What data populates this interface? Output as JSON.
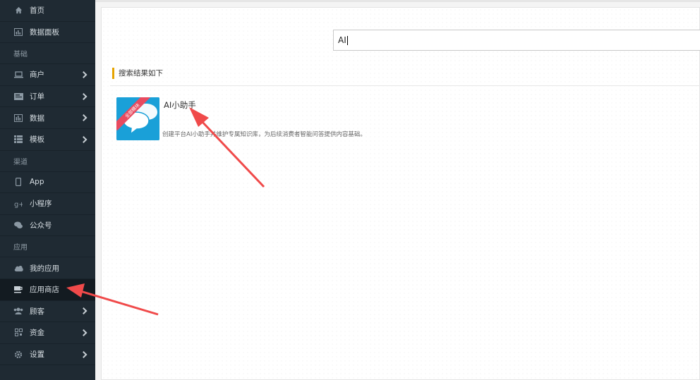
{
  "sidebar": {
    "items": [
      {
        "type": "item",
        "label": "首页",
        "icon": "home-icon",
        "chevron": false,
        "active": false
      },
      {
        "type": "item",
        "label": "数据面板",
        "icon": "chart-icon",
        "chevron": false,
        "active": false
      },
      {
        "type": "section",
        "label": "基础"
      },
      {
        "type": "item",
        "label": "商户",
        "icon": "laptop-icon",
        "chevron": true,
        "active": false
      },
      {
        "type": "item",
        "label": "订单",
        "icon": "order-card-icon",
        "chevron": true,
        "active": false
      },
      {
        "type": "item",
        "label": "数据",
        "icon": "bar-chart-icon",
        "chevron": true,
        "active": false
      },
      {
        "type": "item",
        "label": "模板",
        "icon": "list-icon",
        "chevron": true,
        "active": false
      },
      {
        "type": "section",
        "label": "渠道"
      },
      {
        "type": "item",
        "label": "App",
        "icon": "mobile-icon",
        "chevron": false,
        "active": false
      },
      {
        "type": "item",
        "label": "小程序",
        "icon": "miniprogram-icon",
        "chevron": false,
        "active": false
      },
      {
        "type": "item",
        "label": "公众号",
        "icon": "chat-bubbles-icon",
        "chevron": false,
        "active": false
      },
      {
        "type": "section",
        "label": "应用"
      },
      {
        "type": "item",
        "label": "我的应用",
        "icon": "cloud-icon",
        "chevron": false,
        "active": false
      },
      {
        "type": "item",
        "label": "应用商店",
        "icon": "cup-icon",
        "chevron": false,
        "active": true
      },
      {
        "type": "item",
        "label": "顾客",
        "icon": "users-icon",
        "chevron": true,
        "active": false
      },
      {
        "type": "item",
        "label": "资金",
        "icon": "qrcode-icon",
        "chevron": true,
        "active": false
      },
      {
        "type": "item",
        "label": "设置",
        "icon": "gear-icon",
        "chevron": true,
        "active": false
      }
    ]
  },
  "search": {
    "value": "AI"
  },
  "results": {
    "title": "搜索结果如下",
    "apps": [
      {
        "name": "AI小助手",
        "badge": "全部模块",
        "description": "创建平台AI小助手并维护专属知识库，为后续消费者智能问答提供内容基础。"
      }
    ]
  },
  "colors": {
    "sidebar_bg": "#1f2a33",
    "accent_bar": "#e6a400",
    "app_icon_bg": "#1aa0d8",
    "annotation_arrow": "#f04a4a",
    "badge_red": "#e84a5f"
  }
}
